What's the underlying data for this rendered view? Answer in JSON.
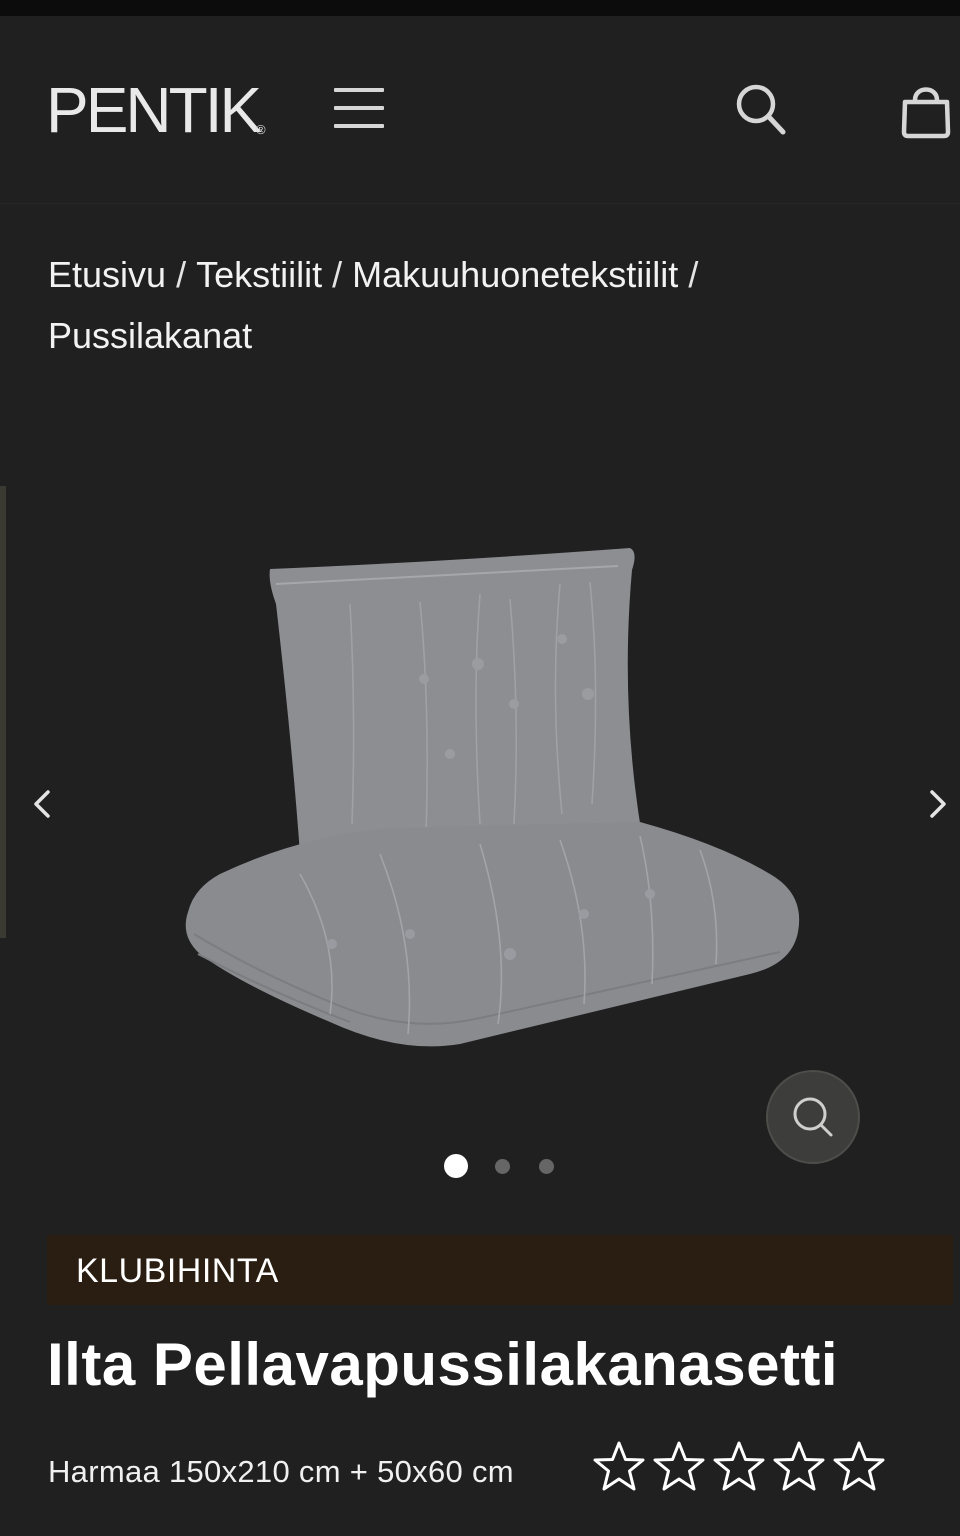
{
  "header": {
    "logo_text": "PENTIK",
    "logo_mark": "®",
    "menu_icon": "hamburger-menu-icon",
    "search_icon": "search-icon",
    "cart_icon": "shopping-bag-icon"
  },
  "breadcrumb": {
    "items": [
      "Etusivu",
      "Tekstiilit",
      "Makuuhuonetekstiilit",
      "Pussilakanat"
    ],
    "separator": "/"
  },
  "gallery": {
    "image_alt": "Harmaa pellavapussilakanasetti: tyyny ja taiteltu peitto",
    "slide_count": 3,
    "active_index": 0,
    "prev_icon": "chevron-left-icon",
    "next_icon": "chevron-right-icon",
    "zoom_icon": "zoom-icon"
  },
  "product": {
    "badge": "KLUBIHINTA",
    "title": "Ilta Pellavapussilakanasetti",
    "variant": "Harmaa 150x210 cm + 50x60 cm",
    "rating_stars_filled": 0,
    "rating_stars_total": 5
  },
  "colors": {
    "background": "#202020",
    "badge_background": "#2a1e12",
    "text": "#ffffff",
    "product_grey": "#8d8f93"
  }
}
